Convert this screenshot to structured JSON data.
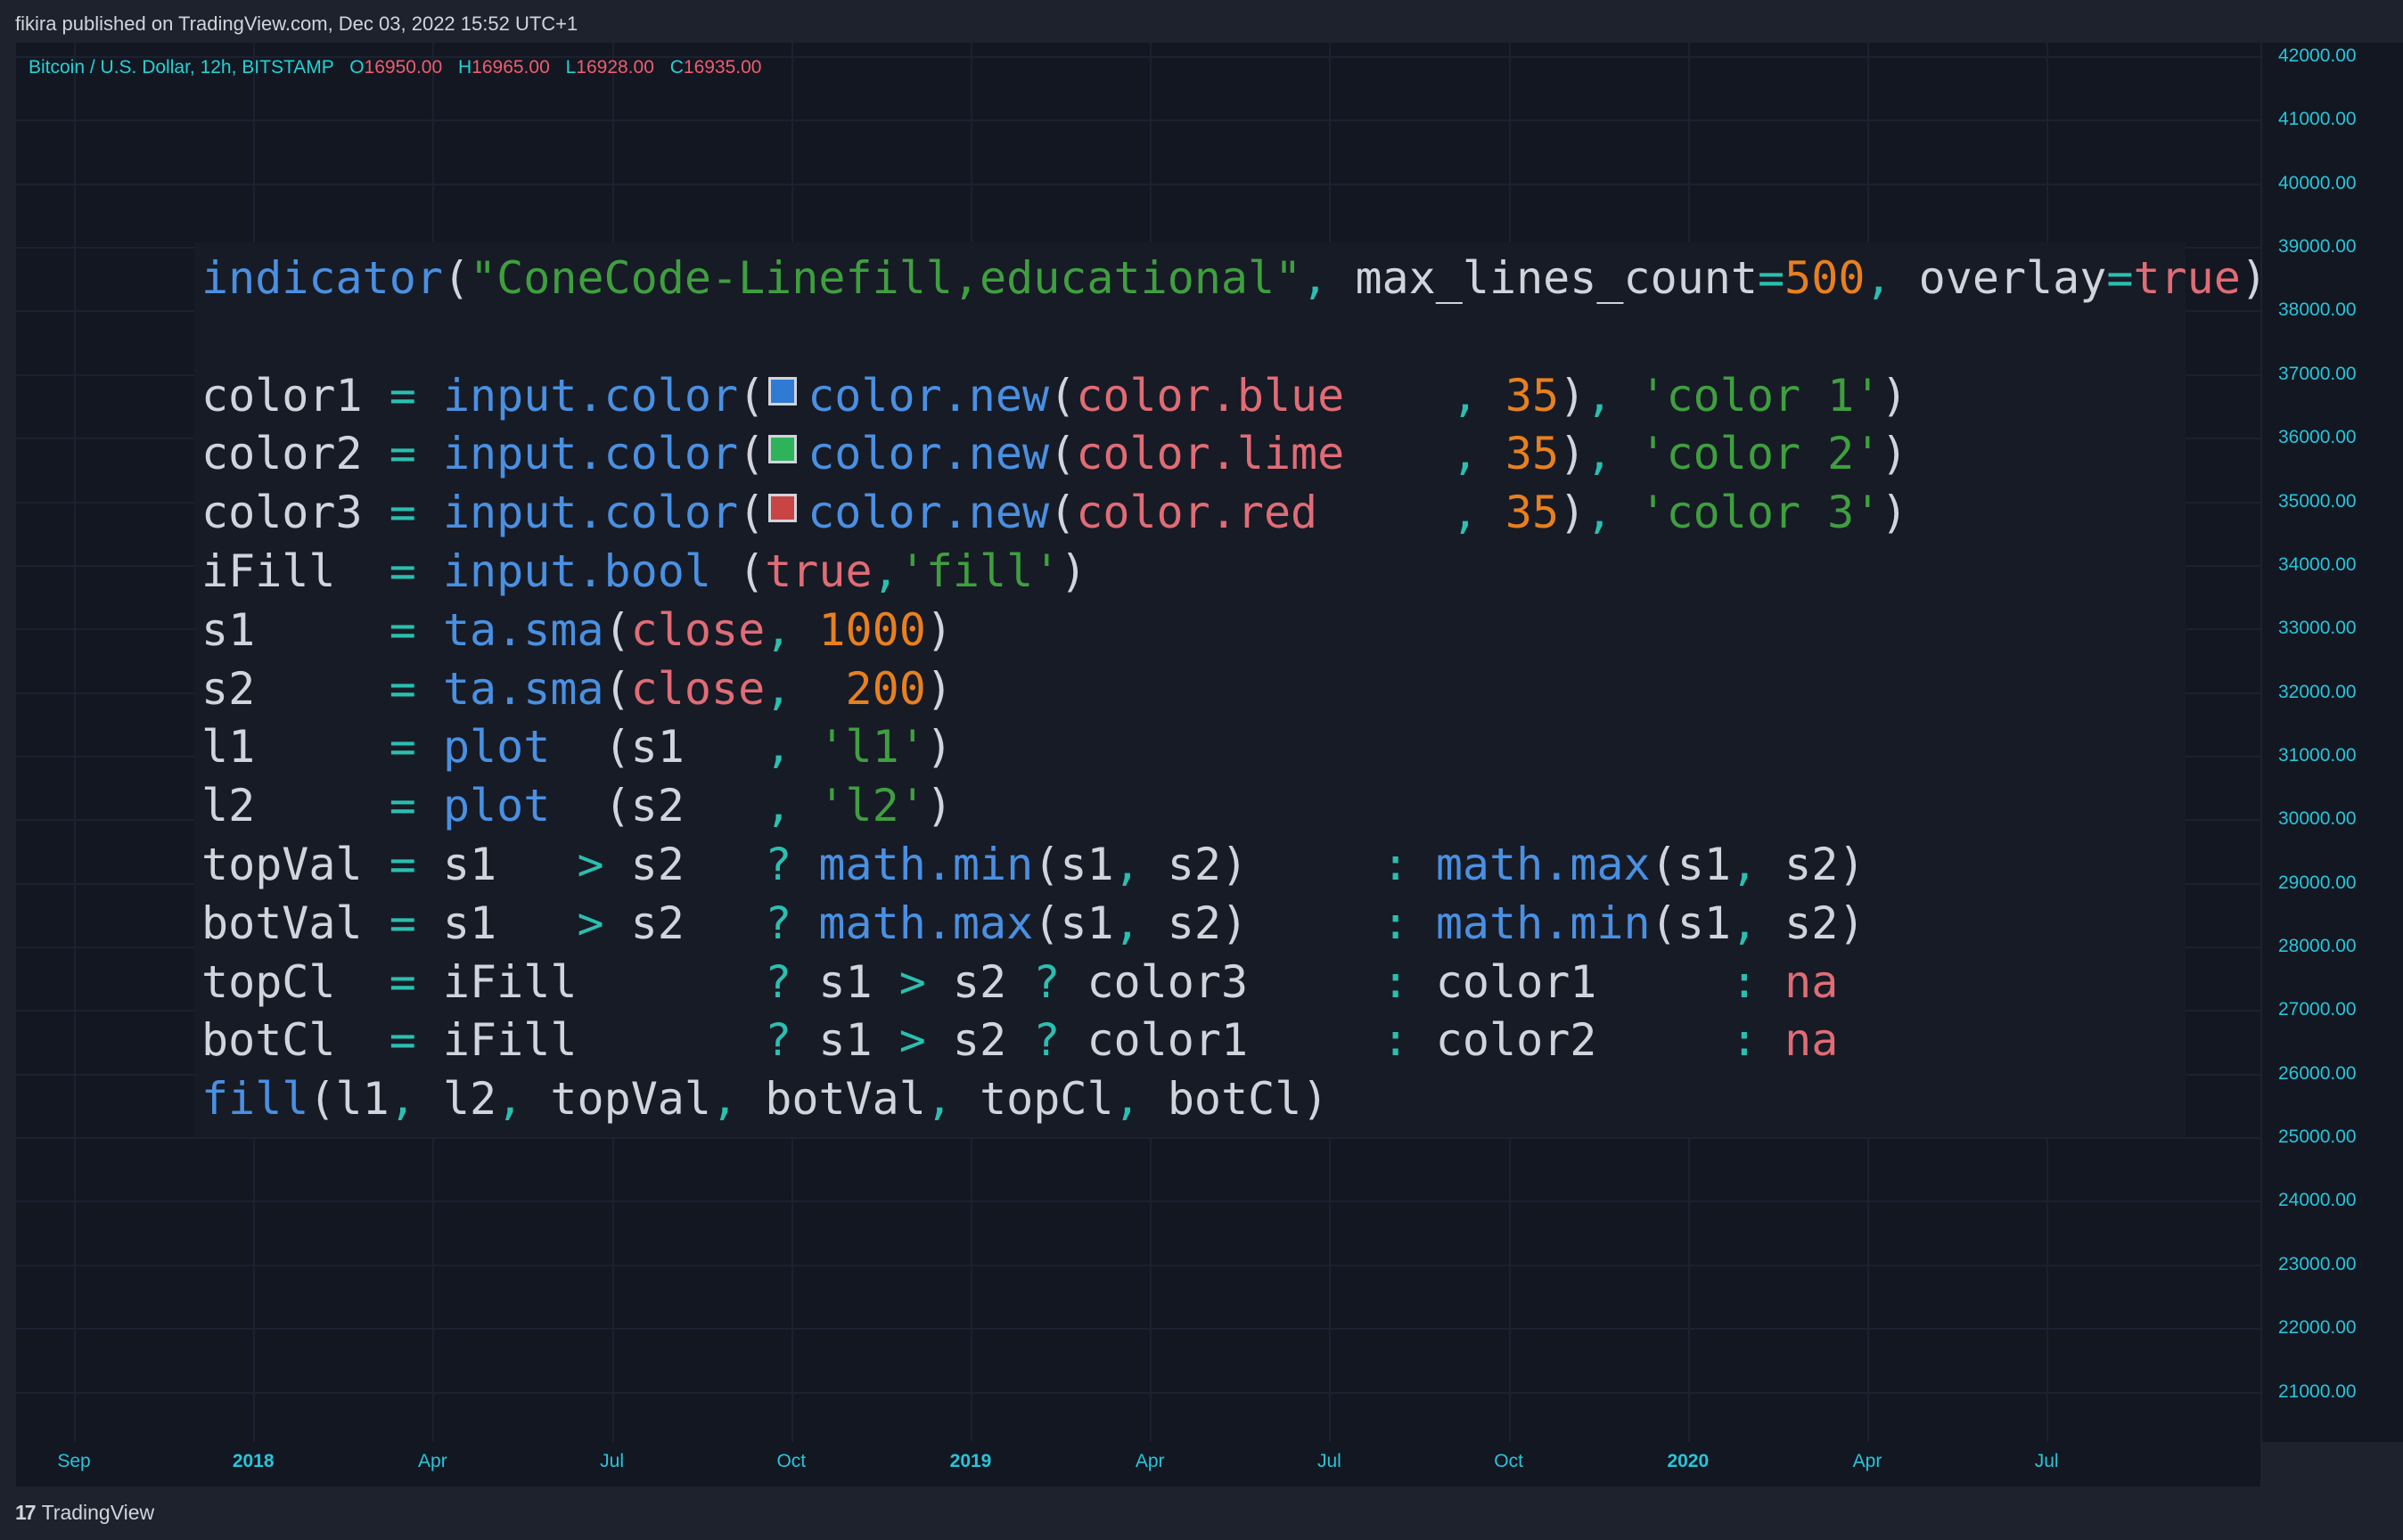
{
  "header": {
    "published_text": "fikira published on TradingView.com, Dec 03, 2022 15:52 UTC+1"
  },
  "legend": {
    "symbol": "Bitcoin / U.S. Dollar, 12h, BITSTAMP",
    "o_label": "O",
    "o_value": "16950.00",
    "h_label": "H",
    "h_value": "16965.00",
    "l_label": "L",
    "l_value": "16928.00",
    "c_label": "C",
    "c_value": "16935.00"
  },
  "colors": {
    "background": "#131722",
    "axis_text": "#26c6da",
    "swatch_blue": "#2f7bd4",
    "swatch_lime": "#2fb35a",
    "swatch_red": "#c94444"
  },
  "y_axis": {
    "ticks": [
      "42000.00",
      "41000.00",
      "40000.00",
      "39000.00",
      "38000.00",
      "37000.00",
      "36000.00",
      "35000.00",
      "34000.00",
      "33000.00",
      "32000.00",
      "31000.00",
      "30000.00",
      "29000.00",
      "28000.00",
      "27000.00",
      "26000.00",
      "25000.00",
      "24000.00",
      "23000.00",
      "22000.00",
      "21000.00"
    ]
  },
  "x_axis": {
    "ticks": [
      {
        "label": "Sep",
        "year": false
      },
      {
        "label": "2018",
        "year": true
      },
      {
        "label": "Apr",
        "year": false
      },
      {
        "label": "Jul",
        "year": false
      },
      {
        "label": "Oct",
        "year": false
      },
      {
        "label": "2019",
        "year": true
      },
      {
        "label": "Apr",
        "year": false
      },
      {
        "label": "Jul",
        "year": false
      },
      {
        "label": "Oct",
        "year": false
      },
      {
        "label": "2020",
        "year": true
      },
      {
        "label": "Apr",
        "year": false
      },
      {
        "label": "Jul",
        "year": false
      }
    ]
  },
  "code": {
    "lines": [
      [
        [
          "fn",
          "indicator"
        ],
        [
          "id",
          "("
        ],
        [
          "str",
          "\"ConeCode-Linefill,educational\""
        ],
        [
          "op",
          ", "
        ],
        [
          "id",
          "max_lines_count"
        ],
        [
          "op",
          "="
        ],
        [
          "num",
          "500"
        ],
        [
          "op",
          ", "
        ],
        [
          "id",
          "overlay"
        ],
        [
          "op",
          "="
        ],
        [
          "kw",
          "true"
        ],
        [
          "id",
          ")"
        ]
      ],
      [],
      [
        [
          "id",
          "color1 "
        ],
        [
          "op",
          "="
        ],
        [
          "id",
          " "
        ],
        [
          "fn",
          "input.color"
        ],
        [
          "id",
          "("
        ],
        [
          "swatch",
          "swatch_blue"
        ],
        [
          "fn",
          "color.new"
        ],
        [
          "id",
          "("
        ],
        [
          "kw",
          "color.blue   "
        ],
        [
          "op",
          " , "
        ],
        [
          "num",
          "35"
        ],
        [
          "id",
          ")"
        ],
        [
          "op",
          ", "
        ],
        [
          "str",
          "'color 1'"
        ],
        [
          "id",
          ")"
        ]
      ],
      [
        [
          "id",
          "color2 "
        ],
        [
          "op",
          "="
        ],
        [
          "id",
          " "
        ],
        [
          "fn",
          "input.color"
        ],
        [
          "id",
          "("
        ],
        [
          "swatch",
          "swatch_lime"
        ],
        [
          "fn",
          "color.new"
        ],
        [
          "id",
          "("
        ],
        [
          "kw",
          "color.lime   "
        ],
        [
          "op",
          " , "
        ],
        [
          "num",
          "35"
        ],
        [
          "id",
          ")"
        ],
        [
          "op",
          ", "
        ],
        [
          "str",
          "'color 2'"
        ],
        [
          "id",
          ")"
        ]
      ],
      [
        [
          "id",
          "color3 "
        ],
        [
          "op",
          "="
        ],
        [
          "id",
          " "
        ],
        [
          "fn",
          "input.color"
        ],
        [
          "id",
          "("
        ],
        [
          "swatch",
          "swatch_red"
        ],
        [
          "fn",
          "color.new"
        ],
        [
          "id",
          "("
        ],
        [
          "kw",
          "color.red    "
        ],
        [
          "op",
          " , "
        ],
        [
          "num",
          "35"
        ],
        [
          "id",
          ")"
        ],
        [
          "op",
          ", "
        ],
        [
          "str",
          "'color 3'"
        ],
        [
          "id",
          ")"
        ]
      ],
      [
        [
          "id",
          "iFill  "
        ],
        [
          "op",
          "="
        ],
        [
          "id",
          " "
        ],
        [
          "fn",
          "input.bool"
        ],
        [
          "id",
          " ("
        ],
        [
          "kw",
          "true"
        ],
        [
          "op",
          ","
        ],
        [
          "str",
          "'fill'"
        ],
        [
          "id",
          ")"
        ]
      ],
      [
        [
          "id",
          "s1     "
        ],
        [
          "op",
          "="
        ],
        [
          "id",
          " "
        ],
        [
          "fn",
          "ta.sma"
        ],
        [
          "id",
          "("
        ],
        [
          "kw",
          "close"
        ],
        [
          "op",
          ", "
        ],
        [
          "num",
          "1000"
        ],
        [
          "id",
          ")"
        ]
      ],
      [
        [
          "id",
          "s2     "
        ],
        [
          "op",
          "="
        ],
        [
          "id",
          " "
        ],
        [
          "fn",
          "ta.sma"
        ],
        [
          "id",
          "("
        ],
        [
          "kw",
          "close"
        ],
        [
          "op",
          ",  "
        ],
        [
          "num",
          "200"
        ],
        [
          "id",
          ")"
        ]
      ],
      [
        [
          "id",
          "l1     "
        ],
        [
          "op",
          "="
        ],
        [
          "id",
          " "
        ],
        [
          "fn",
          "plot"
        ],
        [
          "id",
          "  (s1   "
        ],
        [
          "op",
          ", "
        ],
        [
          "str",
          "'l1'"
        ],
        [
          "id",
          ")"
        ]
      ],
      [
        [
          "id",
          "l2     "
        ],
        [
          "op",
          "="
        ],
        [
          "id",
          " "
        ],
        [
          "fn",
          "plot"
        ],
        [
          "id",
          "  (s2   "
        ],
        [
          "op",
          ", "
        ],
        [
          "str",
          "'l2'"
        ],
        [
          "id",
          ")"
        ]
      ],
      [
        [
          "id",
          "topVal "
        ],
        [
          "op",
          "="
        ],
        [
          "id",
          " s1   "
        ],
        [
          "op",
          ">"
        ],
        [
          "id",
          " s2   "
        ],
        [
          "op",
          "?"
        ],
        [
          "id",
          " "
        ],
        [
          "fn",
          "math.min"
        ],
        [
          "id",
          "(s1"
        ],
        [
          "op",
          ", "
        ],
        [
          "id",
          "s2)     "
        ],
        [
          "op",
          ":"
        ],
        [
          "id",
          " "
        ],
        [
          "fn",
          "math.max"
        ],
        [
          "id",
          "(s1"
        ],
        [
          "op",
          ", "
        ],
        [
          "id",
          "s2)"
        ]
      ],
      [
        [
          "id",
          "botVal "
        ],
        [
          "op",
          "="
        ],
        [
          "id",
          " s1   "
        ],
        [
          "op",
          ">"
        ],
        [
          "id",
          " s2   "
        ],
        [
          "op",
          "?"
        ],
        [
          "id",
          " "
        ],
        [
          "fn",
          "math.max"
        ],
        [
          "id",
          "(s1"
        ],
        [
          "op",
          ", "
        ],
        [
          "id",
          "s2)     "
        ],
        [
          "op",
          ":"
        ],
        [
          "id",
          " "
        ],
        [
          "fn",
          "math.min"
        ],
        [
          "id",
          "(s1"
        ],
        [
          "op",
          ", "
        ],
        [
          "id",
          "s2)"
        ]
      ],
      [
        [
          "id",
          "topCl  "
        ],
        [
          "op",
          "="
        ],
        [
          "id",
          " iFill       "
        ],
        [
          "op",
          "?"
        ],
        [
          "id",
          " s1 "
        ],
        [
          "op",
          ">"
        ],
        [
          "id",
          " s2 "
        ],
        [
          "op",
          "?"
        ],
        [
          "id",
          " color3     "
        ],
        [
          "op",
          ":"
        ],
        [
          "id",
          " color1     "
        ],
        [
          "op",
          ":"
        ],
        [
          "id",
          " "
        ],
        [
          "kw",
          "na"
        ]
      ],
      [
        [
          "id",
          "botCl  "
        ],
        [
          "op",
          "="
        ],
        [
          "id",
          " iFill       "
        ],
        [
          "op",
          "?"
        ],
        [
          "id",
          " s1 "
        ],
        [
          "op",
          ">"
        ],
        [
          "id",
          " s2 "
        ],
        [
          "op",
          "?"
        ],
        [
          "id",
          " color1     "
        ],
        [
          "op",
          ":"
        ],
        [
          "id",
          " color2     "
        ],
        [
          "op",
          ":"
        ],
        [
          "id",
          " "
        ],
        [
          "kw",
          "na"
        ]
      ],
      [
        [
          "fn",
          "fill"
        ],
        [
          "id",
          "(l1"
        ],
        [
          "op",
          ", "
        ],
        [
          "id",
          "l2"
        ],
        [
          "op",
          ", "
        ],
        [
          "id",
          "topVal"
        ],
        [
          "op",
          ", "
        ],
        [
          "id",
          "botVal"
        ],
        [
          "op",
          ", "
        ],
        [
          "id",
          "topCl"
        ],
        [
          "op",
          ", "
        ],
        [
          "id",
          "botCl)"
        ]
      ]
    ]
  },
  "footer": {
    "brand": "TradingView",
    "logo_mark": "17"
  }
}
